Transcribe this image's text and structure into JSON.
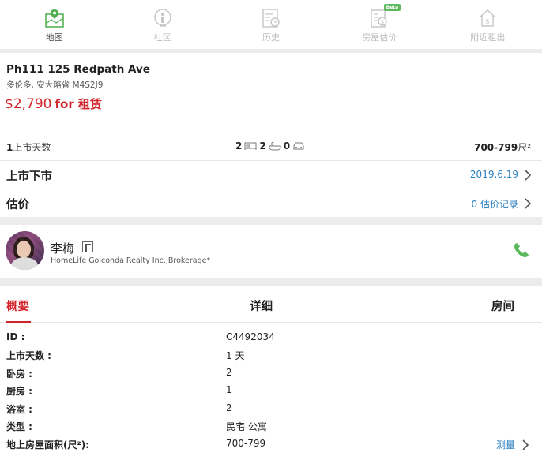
{
  "nav": {
    "items": [
      {
        "label": "地图",
        "icon": "map-icon",
        "active": true
      },
      {
        "label": "社区",
        "icon": "person-pin-icon",
        "active": false
      },
      {
        "label": "历史",
        "icon": "history-icon",
        "active": false
      },
      {
        "label": "房屋估价",
        "icon": "valuation-icon",
        "active": false,
        "badge": "Beta"
      },
      {
        "label": "附近租出",
        "icon": "house-dollar-icon",
        "active": false
      }
    ]
  },
  "listing": {
    "address": "Ph111 125 Redpath Ave",
    "city": "多伦多, 安大略省 M4S2J9",
    "price": "$2,790",
    "price_suffix": "for 租赁",
    "days_count": "1",
    "days_label": "上市天数",
    "beds": "2",
    "baths": "2",
    "parking": "0",
    "sqft": "700-799",
    "sqft_unit": "尺²",
    "rows": {
      "listing_title": "上市下市",
      "listing_value": "2019.6.19",
      "estimate_title": "估价",
      "estimate_value": "0 估价记录"
    }
  },
  "agent": {
    "name": "李梅",
    "broker": "HomeLife Golconda Realty Inc.,Brokerage*"
  },
  "details": {
    "tabs": [
      "概要",
      "详细",
      "房间"
    ],
    "rows": [
      {
        "k": "ID :",
        "v": "C4492034"
      },
      {
        "k": "上市天数 :",
        "v": "1 天"
      },
      {
        "k": "卧房 :",
        "v": "2"
      },
      {
        "k": "厨房 :",
        "v": "1"
      },
      {
        "k": "浴室 :",
        "v": "2"
      },
      {
        "k": "类型 :",
        "v": "民宅 公寓"
      },
      {
        "k": "地上房屋面积(尺²):",
        "v": "700-799"
      }
    ],
    "measure_label": "测量"
  },
  "colors": {
    "accent_red": "#d2232a",
    "link_blue": "#2a7fbf",
    "phone_green": "#5cb85c",
    "nav_active_green": "#4cae4c"
  }
}
